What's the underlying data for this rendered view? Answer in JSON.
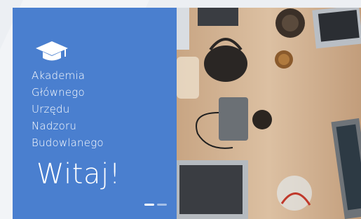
{
  "hero": {
    "org_name_lines": [
      "Akademia",
      "Głównego",
      "Urzędu",
      "Nadzoru",
      "Budowlanego"
    ],
    "welcome": "Witaj!",
    "icon": "graduation-cap-icon",
    "panel_color": "#4a7fcf",
    "text_color": "#ffffff"
  },
  "photo": {
    "subject": "",
    "icon": "desk-photo"
  },
  "slider": {
    "active_index": 0,
    "count": 2
  }
}
